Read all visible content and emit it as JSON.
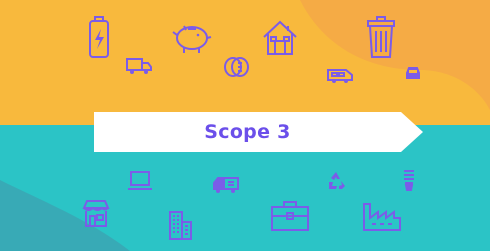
{
  "colors": {
    "top": "#F8B93D",
    "top_blob": "#F7A946",
    "bottom": "#2BC4C6",
    "bottom_blob": "#3DA9B4",
    "icon": "#7B5CE8",
    "banner": "#FFFFFF",
    "banner_text": "#6B4FEA"
  },
  "banner": {
    "label": "Scope 3"
  },
  "icons": {
    "top": [
      "battery-bolt-icon",
      "piggy-bank-icon",
      "house-icon",
      "trash-can-icon",
      "delivery-truck-icon",
      "coins-icon",
      "van-icon",
      "car-icon"
    ],
    "bottom": [
      "laptop-icon",
      "shipping-truck-icon",
      "recycle-icon",
      "light-bulb-icon",
      "storefront-icon",
      "office-building-icon",
      "briefcase-icon",
      "factory-icon"
    ]
  }
}
